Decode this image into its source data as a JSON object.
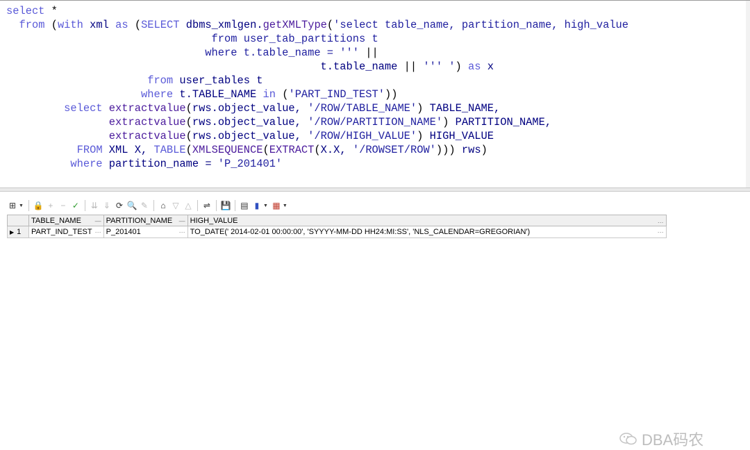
{
  "editor": {
    "lines": [
      "select *",
      "  from (with xml as (SELECT dbms_xmlgen.getXMLType('select table_name, partition_name, high_value",
      "                                from user_tab_partitions t",
      "                               where t.table_name = ''' ||",
      "                                                 t.table_name || ''' ') as x",
      "                      from user_tables t",
      "                     where t.TABLE_NAME in ('PART_IND_TEST'))",
      "         select extractvalue(rws.object_value, '/ROW/TABLE_NAME') TABLE_NAME,",
      "                extractvalue(rws.object_value, '/ROW/PARTITION_NAME') PARTITION_NAME,",
      "                extractvalue(rws.object_value, '/ROW/HIGH_VALUE') HIGH_VALUE",
      "           FROM XML X, TABLE(XMLSEQUENCE(EXTRACT(X.X, '/ROWSET/ROW'))) rws)",
      "          where partition_name = 'P_201401'"
    ]
  },
  "toolbar": {
    "buttons": [
      {
        "name": "grid-options-icon",
        "glyph": "⊞",
        "enabled": true
      },
      {
        "name": "lock-icon",
        "glyph": "🔒",
        "enabled": true
      },
      {
        "name": "add-record-icon",
        "glyph": "+",
        "enabled": false
      },
      {
        "name": "delete-record-icon",
        "glyph": "−",
        "enabled": false
      },
      {
        "name": "post-changes-icon",
        "glyph": "✓",
        "enabled": false
      },
      {
        "name": "fetch-next-icon",
        "glyph": "⇊",
        "enabled": false
      },
      {
        "name": "fetch-last-icon",
        "glyph": "⇓",
        "enabled": false
      },
      {
        "name": "refresh-icon",
        "glyph": "⟳",
        "enabled": true
      },
      {
        "name": "find-icon",
        "glyph": "🔍",
        "enabled": true
      },
      {
        "name": "clear-icon",
        "glyph": "✎",
        "enabled": false
      },
      {
        "name": "query-by-example-icon",
        "glyph": "⌂",
        "enabled": true
      },
      {
        "name": "next-record-icon",
        "glyph": "▽",
        "enabled": false
      },
      {
        "name": "previous-record-icon",
        "glyph": "△",
        "enabled": false
      },
      {
        "name": "single-record-view-icon",
        "glyph": "⇌",
        "enabled": true
      },
      {
        "name": "save-icon",
        "glyph": "💾",
        "enabled": true
      },
      {
        "name": "export-icon",
        "glyph": "▤",
        "enabled": true
      },
      {
        "name": "chart-icon",
        "glyph": "▮",
        "enabled": true
      },
      {
        "name": "table-icon",
        "glyph": "▦",
        "enabled": true
      }
    ]
  },
  "results": {
    "columns": [
      "TABLE_NAME",
      "PARTITION_NAME",
      "HIGH_VALUE"
    ],
    "rows": [
      {
        "num": "1",
        "table_name": "PART_IND_TEST",
        "partition_name": "P_201401",
        "high_value": "TO_DATE(' 2014-02-01 00:00:00', 'SYYYY-MM-DD HH24:MI:SS', 'NLS_CALENDAR=GREGORIAN')"
      }
    ]
  },
  "watermark": {
    "text": "DBA码农"
  }
}
